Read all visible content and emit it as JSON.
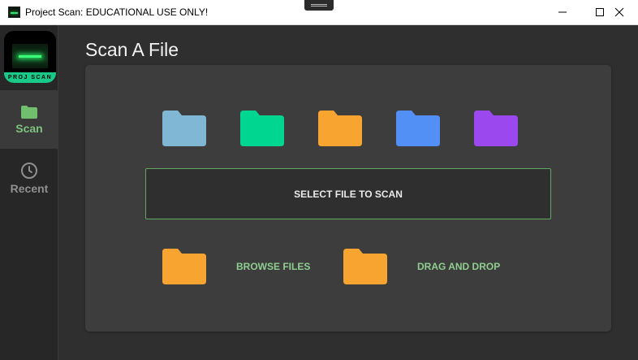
{
  "window": {
    "title": "Project Scan: EDUCATIONAL USE ONLY!",
    "controls": [
      "minimize-icon",
      "maximize-icon",
      "close-icon"
    ]
  },
  "sidebar": {
    "logo_text": "PROJ SCAN",
    "items": [
      {
        "label": "Scan",
        "icon": "folder-icon",
        "active": true
      },
      {
        "label": "Recent",
        "icon": "clock-icon",
        "active": false
      }
    ]
  },
  "main": {
    "title": "Scan A File",
    "folder_colors": [
      "#7fb7d5",
      "#00d690",
      "#f8a431",
      "#5290f5",
      "#9b49ef"
    ],
    "select_button": "SELECT FILE TO SCAN",
    "actions": [
      {
        "label": "BROWSE FILES",
        "icon": "folder-icon",
        "color": "#f8a431"
      },
      {
        "label": "DRAG AND DROP",
        "icon": "folder-icon",
        "color": "#f8a431"
      }
    ]
  },
  "colors": {
    "accent_green": "#7dc37d",
    "background": "#2f2f2f",
    "card": "#3d3d3d",
    "sidebar": "#272727"
  }
}
